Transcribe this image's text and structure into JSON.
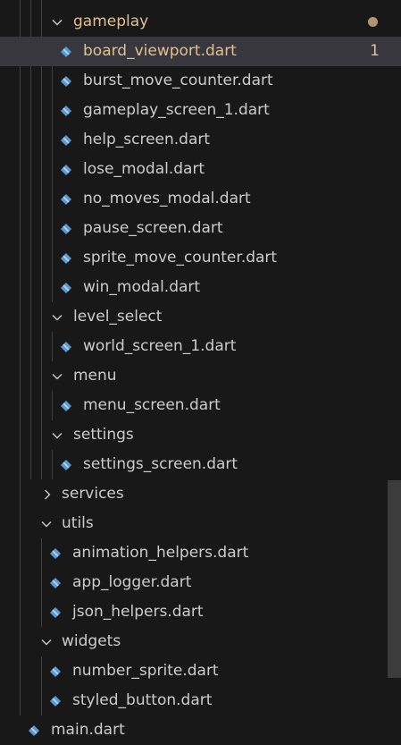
{
  "explorer": {
    "folders": {
      "gameplay": "gameplay",
      "level_select": "level_select",
      "menu": "menu",
      "settings": "settings",
      "services": "services",
      "utils": "utils",
      "widgets": "widgets"
    },
    "gameplay_files": [
      {
        "name": "board_viewport.dart",
        "badge": "1"
      },
      {
        "name": "burst_move_counter.dart"
      },
      {
        "name": "gameplay_screen_1.dart"
      },
      {
        "name": "help_screen.dart"
      },
      {
        "name": "lose_modal.dart"
      },
      {
        "name": "no_moves_modal.dart"
      },
      {
        "name": "pause_screen.dart"
      },
      {
        "name": "sprite_move_counter.dart"
      },
      {
        "name": "win_modal.dart"
      }
    ],
    "level_select_files": [
      {
        "name": "world_screen_1.dart"
      }
    ],
    "menu_files": [
      {
        "name": "menu_screen.dart"
      }
    ],
    "settings_files": [
      {
        "name": "settings_screen.dart"
      }
    ],
    "utils_files": [
      {
        "name": "animation_helpers.dart"
      },
      {
        "name": "app_logger.dart"
      },
      {
        "name": "json_helpers.dart"
      }
    ],
    "widgets_files": [
      {
        "name": "number_sprite.dart"
      },
      {
        "name": "styled_button.dart"
      }
    ],
    "root_files": [
      {
        "name": "main.dart"
      }
    ],
    "icons": {
      "file": "dart-file-icon",
      "expanded": "chevron-down-icon",
      "collapsed": "chevron-right-icon",
      "modified": "modified-dot-icon"
    },
    "colors": {
      "background": "#181818",
      "selected_row": "#37373d",
      "text": "#cccccc",
      "modified_text": "#e2c08d",
      "dart_icon": "#5b9bd5",
      "indent_guide": "#404040"
    }
  }
}
